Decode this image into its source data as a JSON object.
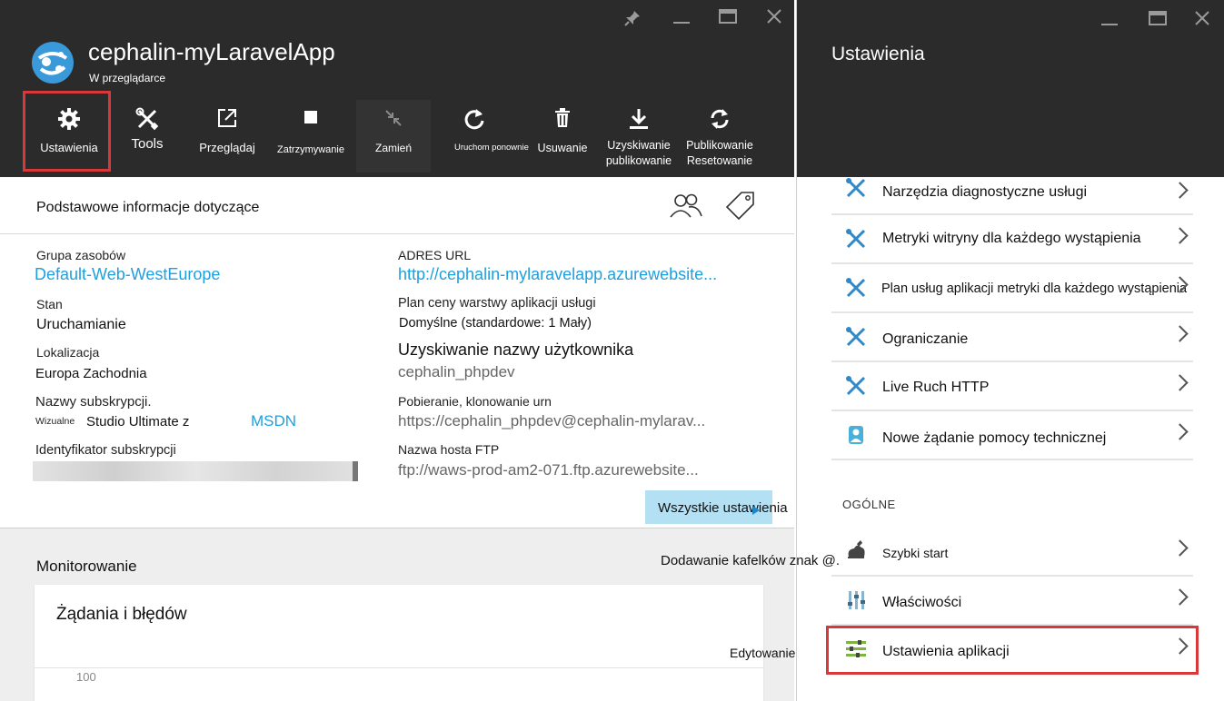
{
  "left_blade": {
    "title": "cephalin-myLaravelApp",
    "subtitle": "W przeglądarce",
    "window_controls": [
      "pin-icon",
      "minimize-icon",
      "maximize-icon",
      "close-icon"
    ],
    "toolbar": [
      {
        "icon": "gear-icon",
        "label": "Ustawienia"
      },
      {
        "icon": "tools-icon",
        "label": "Tools"
      },
      {
        "icon": "browse-icon",
        "label": "Przeglądaj"
      },
      {
        "icon": "stop-icon",
        "label": "Zatrzymywanie"
      },
      {
        "icon": "swap-icon",
        "label": "Zamień"
      },
      {
        "icon": "restart-icon",
        "label": "Uruchom ponownie"
      },
      {
        "icon": "delete-icon",
        "label": "Usuwanie"
      },
      {
        "icon": "download-icon",
        "label": "Uzyskiwanie publikowanie"
      },
      {
        "icon": "reset-icon",
        "label": "Publikowanie Resetowanie"
      }
    ],
    "essentials": {
      "title": "Podstawowe informacje dotyczące",
      "resource_group_label": "Grupa zasobów",
      "resource_group_value": "Default-Web-WestEurope",
      "status_label": "Stan",
      "status_value": "Uruchamianie",
      "location_label": "Lokalizacja",
      "location_value": "Europa Zachodnia",
      "subscription_name_label": "Nazwy subskrypcji.",
      "subscription_prefix": "Wizualne",
      "subscription_value": "Studio Ultimate z",
      "subscription_link": "MSDN",
      "subscription_id_label": "Identyfikator subskrypcji",
      "url_label": "ADRES URL",
      "url_value": "http://cephalin-mylaravelapp.azurewebsite...",
      "plan_label": "Plan ceny warstwy aplikacji usługi",
      "plan_value": "Domyślne (standardowe: 1  Mały)",
      "deploy_user_label": "Uzyskiwanie nazwy użytkownika",
      "deploy_user_value": "cephalin_phpdev",
      "git_label": "Pobieranie, klonowanie urn",
      "git_value": "https://cephalin_phpdev@cephalin-mylarav...",
      "ftp_label": "Nazwa hosta FTP",
      "ftp_value": "ftp://waws-prod-am2-071.ftp.azurewebsite...",
      "all_settings": "Wszystkie ustawienia"
    },
    "monitoring": {
      "title": "Monitorowanie",
      "chart_title": "Żądania i błędów",
      "tick": "100"
    }
  },
  "overlay": {
    "add_tiles": "Dodawanie kafelków znak @.",
    "edit": "Edytowanie"
  },
  "right_blade": {
    "title": "Ustawienia",
    "window_controls": [
      "minimize-icon",
      "maximize-icon",
      "close-icon"
    ],
    "items": [
      {
        "label": "Narzędzia diagnostyczne usługi",
        "icon": "tools-icon"
      },
      {
        "label": "Metryki witryny dla każdego wystąpienia",
        "icon": "tools-icon"
      },
      {
        "label": "Plan usług aplikacji metryki dla każdego wystąpienia",
        "icon": "tools-icon"
      },
      {
        "label": "Ograniczanie",
        "icon": "tools-icon"
      },
      {
        "label": "Live Ruch HTTP",
        "icon": "tools-icon"
      },
      {
        "label": "Nowe żądanie pomocy technicznej",
        "icon": "support-icon"
      }
    ],
    "general_heading": "OGÓLNE",
    "general_items": [
      {
        "label": "Szybki start",
        "icon": "quickstart-icon"
      },
      {
        "label": "Właściwości",
        "icon": "properties-icon"
      },
      {
        "label": "Ustawienia aplikacji",
        "icon": "app-settings-icon"
      }
    ]
  },
  "colors": {
    "header_bg": "#2b2b2b",
    "link": "#1e9fe0",
    "highlight": "#d9383a",
    "tools_icon": "#2f88c8",
    "button_bg": "#b3e0f2"
  }
}
